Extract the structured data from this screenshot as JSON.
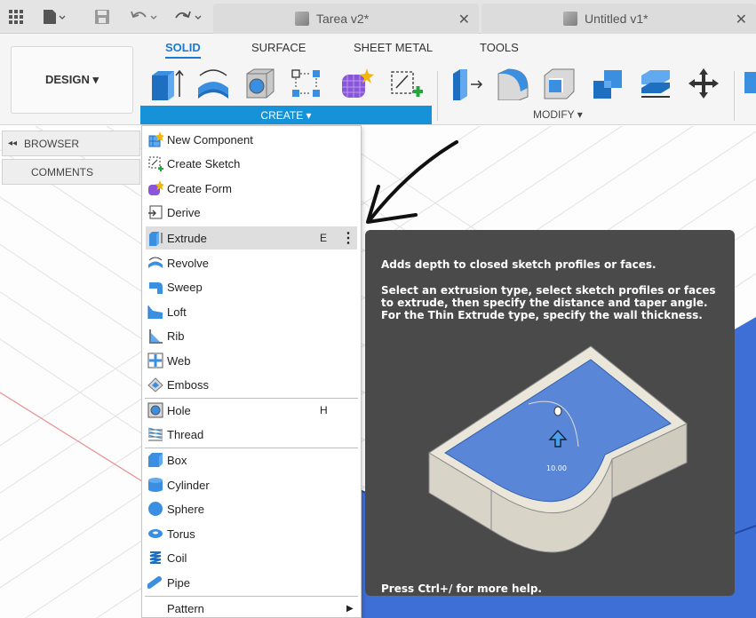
{
  "tabs": [
    {
      "label": "Tarea v2*"
    },
    {
      "label": "Untitled v1*"
    }
  ],
  "toolbar": {
    "design_label": "DESIGN ▾",
    "ribbon_tabs": [
      "SOLID",
      "SURFACE",
      "SHEET METAL",
      "TOOLS"
    ],
    "create_label": "CREATE ▾",
    "modify_label": "MODIFY ▾",
    "accent": "#1592d8"
  },
  "sidebar": {
    "browser": "BROWSER",
    "comments": "COMMENTS"
  },
  "menu": {
    "items": [
      {
        "label": "New Component",
        "icon": "new-component-icon"
      },
      {
        "label": "Create Sketch",
        "icon": "create-sketch-icon"
      },
      {
        "label": "Create Form",
        "icon": "create-form-icon"
      },
      {
        "label": "Derive",
        "icon": "derive-icon"
      },
      {
        "label": "Extrude",
        "icon": "extrude-icon",
        "shortcut": "E",
        "highlighted": true
      },
      {
        "label": "Revolve",
        "icon": "revolve-icon"
      },
      {
        "label": "Sweep",
        "icon": "sweep-icon"
      },
      {
        "label": "Loft",
        "icon": "loft-icon"
      },
      {
        "label": "Rib",
        "icon": "rib-icon"
      },
      {
        "label": "Web",
        "icon": "web-icon"
      },
      {
        "label": "Emboss",
        "icon": "emboss-icon"
      },
      {
        "label": "Hole",
        "icon": "hole-icon",
        "shortcut": "H"
      },
      {
        "label": "Thread",
        "icon": "thread-icon"
      },
      {
        "label": "Box",
        "icon": "box-icon"
      },
      {
        "label": "Cylinder",
        "icon": "cylinder-icon"
      },
      {
        "label": "Sphere",
        "icon": "sphere-icon"
      },
      {
        "label": "Torus",
        "icon": "torus-icon"
      },
      {
        "label": "Coil",
        "icon": "coil-icon"
      },
      {
        "label": "Pipe",
        "icon": "pipe-icon"
      },
      {
        "label": "Pattern",
        "icon": "pattern-icon"
      }
    ]
  },
  "tooltip": {
    "title": "Adds depth to closed sketch profiles or faces.",
    "body": "Select an extrusion type, select sketch profiles or faces to extrude, then specify the distance and taper angle. For the Thin Extrude type, specify the wall thickness.",
    "dimension": "10.00",
    "help": "Press Ctrl+/ for more help."
  }
}
